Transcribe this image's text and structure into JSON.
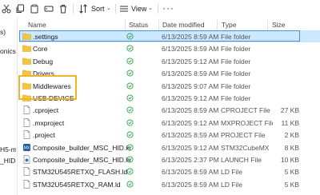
{
  "toolbar": {
    "sort_label": "Sort",
    "view_label": "View",
    "more_label": "···"
  },
  "nav": {
    "items": [
      "s)",
      "onics",
      "H5-m",
      "_HID"
    ]
  },
  "columns": {
    "name": "Name",
    "status": "Status",
    "date": "Date modified",
    "type": "Type",
    "size": "Size"
  },
  "files": [
    {
      "name": ".settings",
      "date": "6/13/2025 8:59 AM",
      "type": "File folder",
      "size": "",
      "icon": "folder-icon",
      "selected": true
    },
    {
      "name": "Core",
      "date": "6/13/2025 8:59 AM",
      "type": "File folder",
      "size": "",
      "icon": "folder-icon"
    },
    {
      "name": "Debug",
      "date": "6/13/2025 9:12 AM",
      "type": "File folder",
      "size": "",
      "icon": "folder-icon"
    },
    {
      "name": "Drivers",
      "date": "6/13/2025 8:59 AM",
      "type": "File folder",
      "size": "",
      "icon": "folder-icon"
    },
    {
      "name": "Middlewares",
      "date": "6/13/2025 9:07 AM",
      "type": "File folder",
      "size": "",
      "icon": "folder-icon"
    },
    {
      "name": "USB DEVICE",
      "date": "6/13/2025 9:12 AM",
      "type": "File folder",
      "size": "",
      "icon": "folder-icon"
    },
    {
      "name": ".cproject",
      "date": "6/13/2025 8:59 AM",
      "type": "CPROJECT File",
      "size": "27 KB",
      "icon": "file-icon"
    },
    {
      "name": ".mxproject",
      "date": "6/13/2025 9:12 AM",
      "type": "MXPROJECT File",
      "size": "11 KB",
      "icon": "file-icon"
    },
    {
      "name": ".project",
      "date": "6/13/2025 8:59 AM",
      "type": "PROJECT File",
      "size": "2 KB",
      "icon": "file-icon"
    },
    {
      "name": "Composite_builder_MSC_HID.ioc",
      "date": "6/13/2025 9:12 AM",
      "type": "STM32CubeMX",
      "size": "8 KB",
      "icon": "mx-file-icon"
    },
    {
      "name": "Composite_builder_MSC_HID.lau...",
      "date": "6/13/2025 2:37 PM",
      "type": "LAUNCH File",
      "size": "10 KB",
      "icon": "launch-file-icon"
    },
    {
      "name": "STM32U545RETXQ_FLASH.ld",
      "date": "6/13/2025 8:59 AM",
      "type": "LD File",
      "size": "5 KB",
      "icon": "file-icon"
    },
    {
      "name": "STM32U545RETXQ_RAM.ld",
      "date": "6/13/2025 8:59 AM",
      "type": "LD File",
      "size": "5 KB",
      "icon": "file-icon"
    }
  ],
  "colors": {
    "folder": "#f5c542",
    "status_ok": "#2e9e44",
    "selection": "#cce8ff",
    "highlight": "#f0b429"
  }
}
